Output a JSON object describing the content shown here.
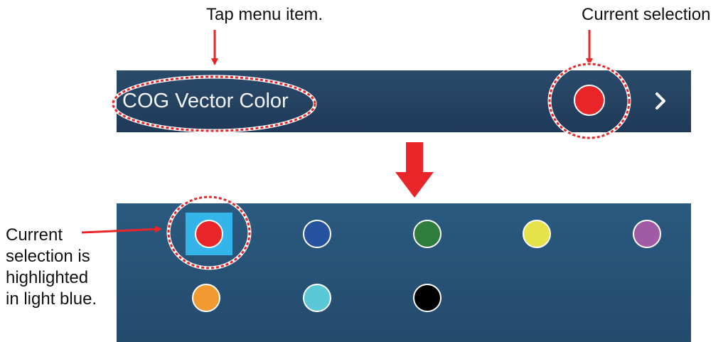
{
  "annotations": {
    "tap": "Tap menu item.",
    "current": "Current selection",
    "highlight_lines": [
      "Current",
      "selection is",
      "highlighted",
      "in light blue."
    ]
  },
  "menu": {
    "label": "COG Vector Color",
    "current_color": "#e8262a",
    "chevron_icon": "chevron-right-icon"
  },
  "palette": {
    "selected_index": 0,
    "selection_color": "#33b5ea",
    "colors": [
      "#e8262a",
      "#2553a0",
      "#2e7d3c",
      "#e6e34a",
      "#a05aa6",
      "#f29a32",
      "#5bc8d8",
      "#000000"
    ]
  },
  "colors": {
    "annotation_red": "#e8262a",
    "bar_background": "#1f3a58",
    "panel_background": "#244a6c"
  }
}
